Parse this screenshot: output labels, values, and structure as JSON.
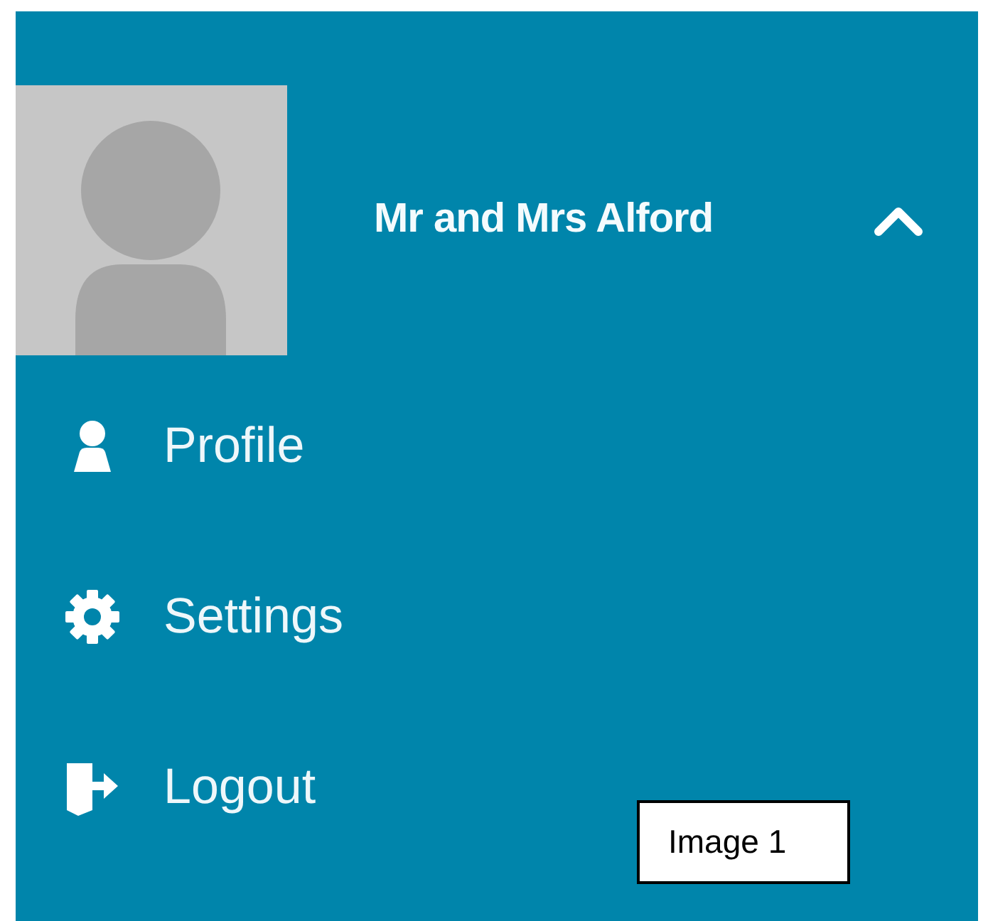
{
  "user_panel": {
    "name": "Mr and Mrs Alford",
    "expanded": true,
    "menu": [
      {
        "kind": "profile",
        "label": "Profile"
      },
      {
        "kind": "settings",
        "label": "Settings"
      },
      {
        "kind": "logout",
        "label": "Logout"
      }
    ]
  },
  "caption": "Image 1"
}
